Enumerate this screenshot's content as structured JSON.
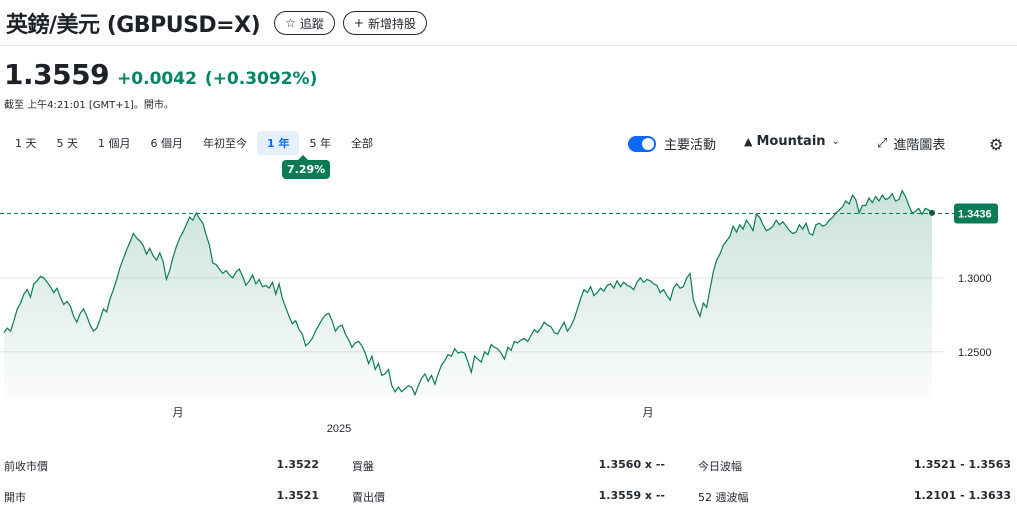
{
  "header": {
    "title": "英鎊/美元 (GBPUSD=X)",
    "follow_label": "追蹤",
    "add_holding_label": "新增持股"
  },
  "quote": {
    "price": "1.3559",
    "change": "+0.0042",
    "change_pct": "(+0.3092%)",
    "as_of": "截至 上午4:21:01 [GMT+1]。開市。"
  },
  "ranges": [
    {
      "label": "1 天",
      "active": false
    },
    {
      "label": "5 天",
      "active": false
    },
    {
      "label": "1 個月",
      "active": false
    },
    {
      "label": "6 個月",
      "active": false
    },
    {
      "label": "年初至今",
      "active": false
    },
    {
      "label": "1 年",
      "active": true
    },
    {
      "label": "5 年",
      "active": false
    },
    {
      "label": "全部",
      "active": false
    }
  ],
  "range_change_badge": "7.29%",
  "controls": {
    "key_events_label": "主要活動",
    "key_events_on": true,
    "chart_type_label": "Mountain",
    "advanced_label": "進階圖表"
  },
  "colors": {
    "up": "#008560",
    "line": "#0d7a55",
    "accent": "#0f69ff",
    "badge": "#0b7a56"
  },
  "chart_data": {
    "type": "area",
    "ylim": [
      1.216,
      1.373
    ],
    "yticks": [
      1.3,
      1.25
    ],
    "ytick_labels": [
      "1.3000",
      "1.2500"
    ],
    "xtick_labels": [
      "月",
      "2025",
      "月"
    ],
    "previous_close": 1.3436,
    "last_label": "1.3436",
    "values": [
      1.263,
      1.266,
      1.264,
      1.271,
      1.279,
      1.283,
      1.289,
      1.292,
      1.287,
      1.296,
      1.298,
      1.301,
      1.3,
      1.297,
      1.294,
      1.29,
      1.293,
      1.287,
      1.282,
      1.284,
      1.281,
      1.274,
      1.27,
      1.276,
      1.279,
      1.274,
      1.268,
      1.264,
      1.266,
      1.272,
      1.279,
      1.277,
      1.286,
      1.292,
      1.299,
      1.307,
      1.313,
      1.319,
      1.324,
      1.33,
      1.327,
      1.325,
      1.322,
      1.316,
      1.32,
      1.315,
      1.312,
      1.317,
      1.311,
      1.299,
      1.305,
      1.314,
      1.321,
      1.327,
      1.331,
      1.336,
      1.341,
      1.339,
      1.344,
      1.34,
      1.337,
      1.329,
      1.322,
      1.31,
      1.309,
      1.306,
      1.303,
      1.305,
      1.302,
      1.3,
      1.304,
      1.306,
      1.301,
      1.295,
      1.298,
      1.302,
      1.296,
      1.299,
      1.294,
      1.295,
      1.293,
      1.297,
      1.289,
      1.296,
      1.286,
      1.28,
      1.274,
      1.269,
      1.271,
      1.265,
      1.262,
      1.254,
      1.256,
      1.259,
      1.264,
      1.268,
      1.272,
      1.275,
      1.276,
      1.271,
      1.264,
      1.267,
      1.268,
      1.262,
      1.258,
      1.253,
      1.256,
      1.257,
      1.254,
      1.249,
      1.242,
      1.247,
      1.238,
      1.242,
      1.234,
      1.235,
      1.238,
      1.227,
      1.223,
      1.226,
      1.223,
      1.225,
      1.227,
      1.226,
      1.221,
      1.227,
      1.232,
      1.235,
      1.23,
      1.234,
      1.228,
      1.235,
      1.241,
      1.244,
      1.248,
      1.247,
      1.252,
      1.249,
      1.25,
      1.249,
      1.243,
      1.236,
      1.247,
      1.245,
      1.243,
      1.25,
      1.248,
      1.255,
      1.253,
      1.252,
      1.249,
      1.245,
      1.253,
      1.251,
      1.257,
      1.256,
      1.258,
      1.259,
      1.257,
      1.261,
      1.265,
      1.263,
      1.266,
      1.27,
      1.268,
      1.267,
      1.263,
      1.262,
      1.266,
      1.27,
      1.264,
      1.267,
      1.272,
      1.279,
      1.286,
      1.292,
      1.29,
      1.294,
      1.288,
      1.29,
      1.293,
      1.291,
      1.295,
      1.296,
      1.293,
      1.298,
      1.294,
      1.297,
      1.295,
      1.294,
      1.292,
      1.297,
      1.3,
      1.297,
      1.299,
      1.298,
      1.296,
      1.295,
      1.29,
      1.292,
      1.288,
      1.285,
      1.293,
      1.296,
      1.293,
      1.294,
      1.3,
      1.303,
      1.285,
      1.279,
      1.274,
      1.283,
      1.28,
      1.292,
      1.304,
      1.312,
      1.316,
      1.322,
      1.325,
      1.328,
      1.335,
      1.331,
      1.336,
      1.333,
      1.339,
      1.336,
      1.332,
      1.343,
      1.341,
      1.336,
      1.332,
      1.333,
      1.335,
      1.339,
      1.336,
      1.338,
      1.335,
      1.332,
      1.33,
      1.331,
      1.336,
      1.333,
      1.337,
      1.33,
      1.329,
      1.336,
      1.337,
      1.335,
      1.336,
      1.339,
      1.341,
      1.344,
      1.346,
      1.348,
      1.352,
      1.35,
      1.356,
      1.353,
      1.344,
      1.349,
      1.349,
      1.354,
      1.351,
      1.355,
      1.352,
      1.356,
      1.353,
      1.354,
      1.357,
      1.352,
      1.353,
      1.359,
      1.355,
      1.349,
      1.344,
      1.345,
      1.347,
      1.343,
      1.347,
      1.346,
      1.344
    ]
  },
  "stats": [
    {
      "label": "前收市價",
      "value": "1.3522",
      "label2": "買盤",
      "value2": "1.3560 x --",
      "label3": "今日波幅",
      "value3": "1.3521 - 1.3563"
    },
    {
      "label": "開市",
      "value": "1.3521",
      "label2": "賣出價",
      "value2": "1.3559 x --",
      "label3": "52 週波幅",
      "value3": "1.2101 - 1.3633"
    }
  ]
}
